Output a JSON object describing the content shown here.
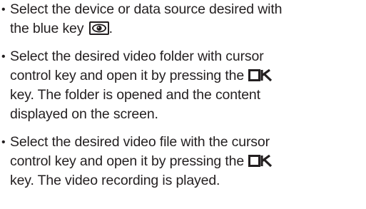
{
  "bullets": [
    {
      "bullet": "•",
      "lines": [
        "Select the device or data source desired with",
        "the blue key"
      ],
      "after_key": "."
    },
    {
      "bullet": "•",
      "lines": [
        "Select the desired video folder with cursor",
        "control key and open it by pressing the"
      ],
      "ok_key": "OK",
      "rest_lines": [
        "key. The folder is opened and the content",
        "displayed on the screen."
      ]
    },
    {
      "bullet": "•",
      "lines": [
        "Select the desired video file with the cursor",
        "control key and open it by pressing the"
      ],
      "ok_key": "OK",
      "rest_lines": [
        "key. The video recording is played."
      ]
    }
  ],
  "icons": {
    "blue_key": "eye-icon",
    "ok_key": "ok-key-icon"
  }
}
